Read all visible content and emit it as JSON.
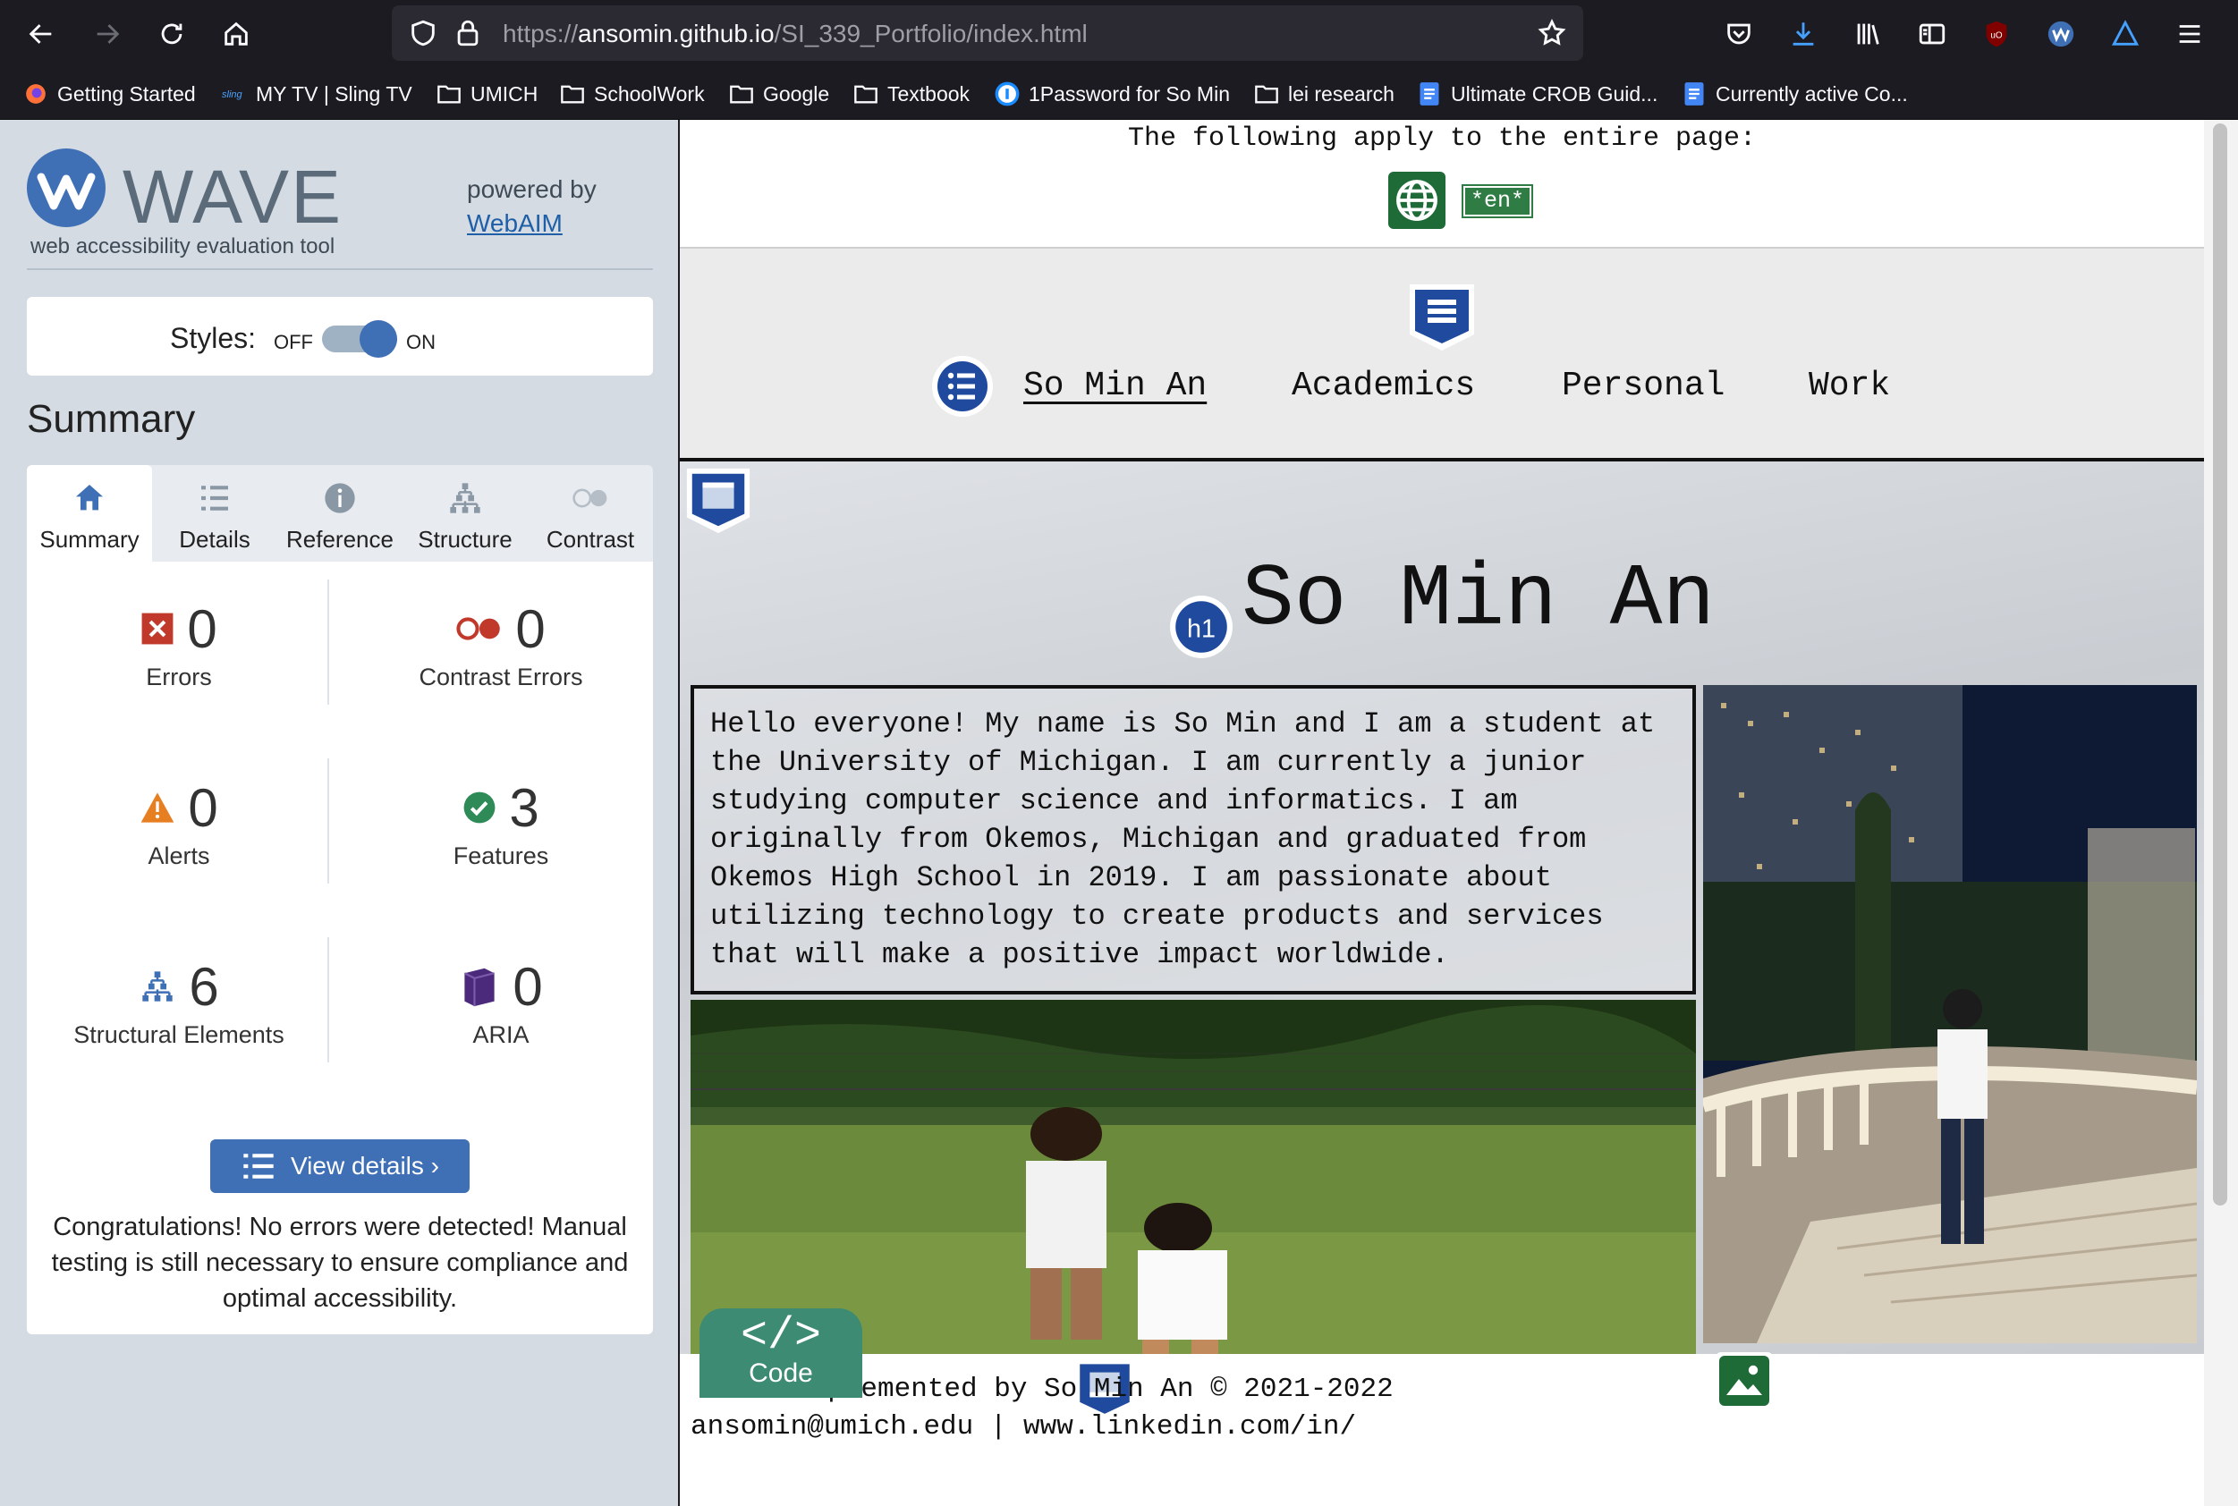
{
  "browser": {
    "url_prefix": "https://",
    "url_domain": "ansomin.github.io",
    "url_path": "/SI_339_Portfolio/index.html",
    "bookmarks": [
      {
        "label": "Getting Started",
        "icon": "firefox-icon"
      },
      {
        "label": "MY TV | Sling TV",
        "icon": "sling-icon"
      },
      {
        "label": "UMICH",
        "icon": "folder-icon"
      },
      {
        "label": "SchoolWork",
        "icon": "folder-icon"
      },
      {
        "label": "Google",
        "icon": "folder-icon"
      },
      {
        "label": "Textbook",
        "icon": "folder-icon"
      },
      {
        "label": "1Password for So Min",
        "icon": "1password-icon"
      },
      {
        "label": "lei research",
        "icon": "folder-icon"
      },
      {
        "label": "Ultimate CROB Guid...",
        "icon": "google-doc-icon"
      },
      {
        "label": "Currently active Co...",
        "icon": "google-doc-icon"
      }
    ]
  },
  "wave": {
    "logo_text": "WAVE",
    "tagline": "web accessibility evaluation tool",
    "powered_by": "powered by",
    "webaim_link": "WebAIM",
    "styles_label": "Styles:",
    "off_label": "OFF",
    "on_label": "ON",
    "styles_on": true,
    "summary_heading": "Summary",
    "tabs": [
      {
        "label": "Summary",
        "icon": "home-icon",
        "active": true
      },
      {
        "label": "Details",
        "icon": "list-icon",
        "active": false
      },
      {
        "label": "Reference",
        "icon": "info-icon",
        "active": false
      },
      {
        "label": "Structure",
        "icon": "hierarchy-icon",
        "active": false
      },
      {
        "label": "Contrast",
        "icon": "contrast-icon",
        "active": false
      }
    ],
    "stats": {
      "errors": {
        "count": "0",
        "label": "Errors"
      },
      "contrast_errors": {
        "count": "0",
        "label": "Contrast Errors"
      },
      "alerts": {
        "count": "0",
        "label": "Alerts"
      },
      "features": {
        "count": "3",
        "label": "Features"
      },
      "structural": {
        "count": "6",
        "label": "Structural Elements"
      },
      "aria": {
        "count": "0",
        "label": "ARIA"
      }
    },
    "view_details_label": "View details ›",
    "congrats": "Congratulations! No errors were detected! Manual testing is still necessary to ensure compliance and optimal accessibility.",
    "colors": {
      "accent": "#3f6fb5",
      "error": "#c0392b",
      "alert": "#e67e22",
      "feature": "#2e8b57",
      "aria": "#4b2a7b"
    }
  },
  "page": {
    "apply_text": "The following apply to the entire page:",
    "lang_badge": "*en*",
    "nav": {
      "home": "So Min An",
      "academics": "Academics",
      "personal": "Personal",
      "work": "Work"
    },
    "h1_badge": "h1",
    "heading": "So Min An",
    "intro": "Hello everyone! My name is So Min and I am a student at the University of Michigan. I am currently a junior studying computer science and informatics. I am originally from Okemos, Michigan and graduated from Okemos High School in 2019. I am passionate about utilizing technology to create products and services that will make a positive impact worldwide.",
    "footer_line1": "Implemented by So Min An © 2021-2022",
    "footer_line2": "ansomin@umich.edu | www.linkedin.com/in/",
    "code_button": "Code",
    "code_glyph": "</>"
  }
}
